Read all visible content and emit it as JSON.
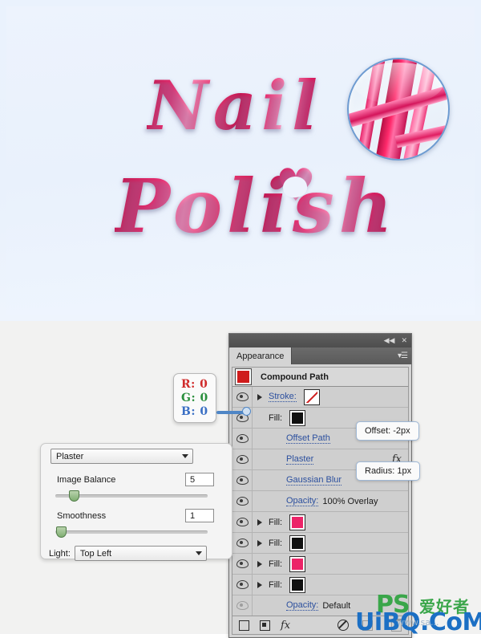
{
  "artwork": {
    "word_top": "Nail",
    "word_bottom": "Polish",
    "heart_glyph": "♥",
    "magnifier_name": "magnifier-loupe"
  },
  "panel": {
    "titlebar": {
      "collapse_glyph": "◀◀",
      "close_glyph": "✕"
    },
    "tab_label": "Appearance",
    "menu_glyph": "▾☰",
    "target_label": "Compound Path",
    "rows": [
      {
        "label": "Stroke:",
        "link": true,
        "arrow": true,
        "eye": true,
        "swatch": "none",
        "value": ""
      },
      {
        "label": "Fill:",
        "link": false,
        "arrow": false,
        "eye": true,
        "swatch": "black",
        "value": ""
      },
      {
        "label": "Offset Path",
        "link": true,
        "arrow": false,
        "eye": true,
        "swatch": "",
        "value": ""
      },
      {
        "label": "Plaster",
        "link": true,
        "arrow": false,
        "eye": true,
        "swatch": "",
        "value": "",
        "fx": "fx"
      },
      {
        "label": "Gaussian Blur",
        "link": true,
        "arrow": false,
        "eye": true,
        "swatch": "",
        "value": ""
      },
      {
        "label": "Opacity:",
        "link": true,
        "arrow": false,
        "eye": true,
        "swatch": "",
        "value": "100% Overlay"
      },
      {
        "label": "Fill:",
        "link": false,
        "arrow": true,
        "eye": true,
        "swatch": "pink",
        "value": ""
      },
      {
        "label": "Fill:",
        "link": false,
        "arrow": true,
        "eye": true,
        "swatch": "black",
        "value": ""
      },
      {
        "label": "Fill:",
        "link": false,
        "arrow": true,
        "eye": true,
        "swatch": "pink",
        "value": ""
      },
      {
        "label": "Fill:",
        "link": false,
        "arrow": true,
        "eye": true,
        "swatch": "black",
        "value": ""
      },
      {
        "label": "Opacity:",
        "link": true,
        "arrow": false,
        "eye": false,
        "swatch": "",
        "value": "Default"
      }
    ],
    "footer": {
      "new_stroke": "add-new-stroke",
      "new_fill": "add-new-fill",
      "fx_label": "fx",
      "clear": "clear-appearance",
      "duplicate": "duplicate-item",
      "delete": "delete-item"
    }
  },
  "rgb_tooltip": {
    "r": "R: 0",
    "g": "G: 0",
    "b": "B: 0",
    "color_r": "#d02b2b",
    "color_g": "#2a8f3d",
    "color_b": "#3a6fc4"
  },
  "callouts": {
    "offset": "Offset: -2px",
    "radius": "Radius: 1px"
  },
  "plaster_dialog": {
    "filter_name": "Plaster",
    "image_balance_label": "Image Balance",
    "image_balance_value": "5",
    "smoothness_label": "Smoothness",
    "smoothness_value": "1",
    "light_label": "Light:",
    "light_value": "Top Left"
  },
  "watermark": {
    "ps": "PS",
    "cn": "爱好者",
    "site": "UiBQ.CoM",
    "www": "www.sa..."
  },
  "colors": {
    "accent_pink": "#ec2468",
    "panel_gray": "#d4d4d4",
    "row_gray": "#cfcfcf",
    "link_blue": "#2b4f9e",
    "canvas_blue": "#eaf2fd"
  }
}
